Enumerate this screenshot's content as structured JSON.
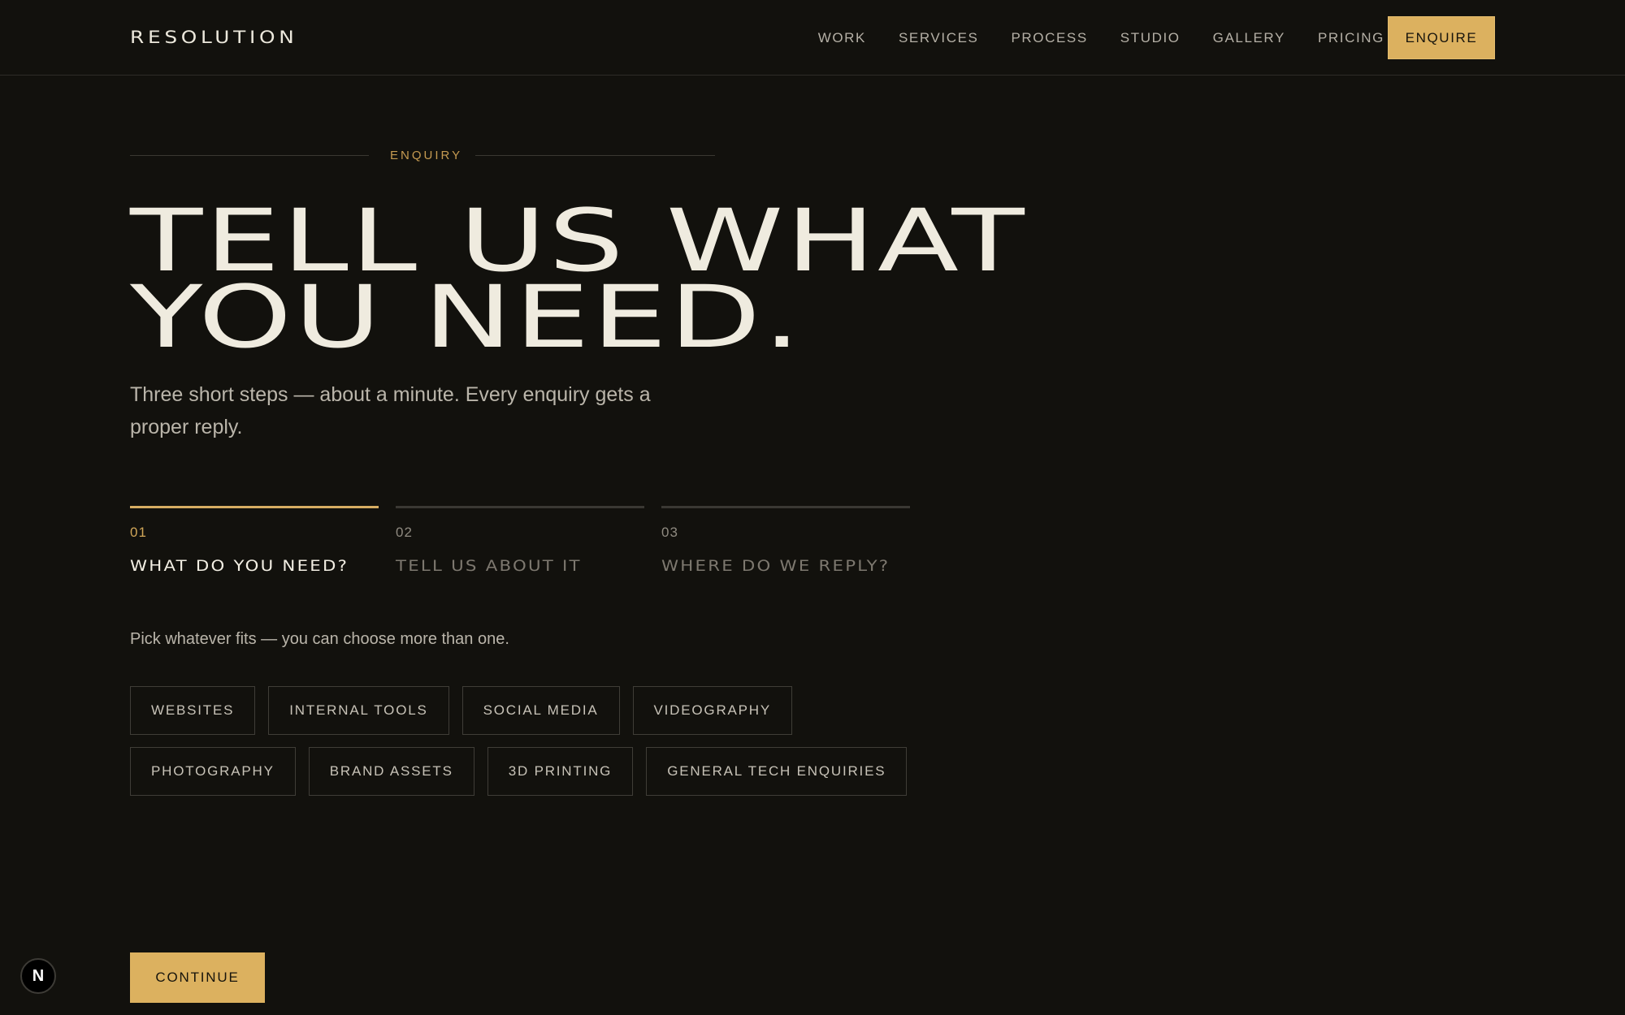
{
  "nav": {
    "logo": "RESOLUTION",
    "links": [
      "WORK",
      "SERVICES",
      "PROCESS",
      "STUDIO",
      "GALLERY",
      "PRICING"
    ],
    "cta": "ENQUIRE"
  },
  "hero": {
    "eyebrow": "ENQUIRY",
    "headline_line1": "TELL US WHAT",
    "headline_line2": "YOU NEED.",
    "subtitle": "Three short steps — about a minute. Every enquiry gets a proper reply."
  },
  "steps": [
    {
      "number": "01",
      "label": "WHAT DO YOU NEED?",
      "active": true
    },
    {
      "number": "02",
      "label": "TELL US ABOUT IT",
      "active": false
    },
    {
      "number": "03",
      "label": "WHERE DO WE REPLY?",
      "active": false
    }
  ],
  "form": {
    "hint": "Pick whatever fits — you can choose more than one.",
    "options_row1": [
      "WEBSITES",
      "INTERNAL TOOLS",
      "SOCIAL MEDIA",
      "VIDEOGRAPHY"
    ],
    "options_row2": [
      "PHOTOGRAPHY",
      "BRAND ASSETS",
      "3D PRINTING",
      "GENERAL TECH ENQUIRIES"
    ],
    "continue_label": "CONTINUE"
  },
  "badge": {
    "letter": "N",
    "icon": "nextjs-icon"
  },
  "colors": {
    "background": "#12110d",
    "accent": "#dcb15f",
    "text": "#efebdf",
    "muted": "#bab5aa"
  }
}
